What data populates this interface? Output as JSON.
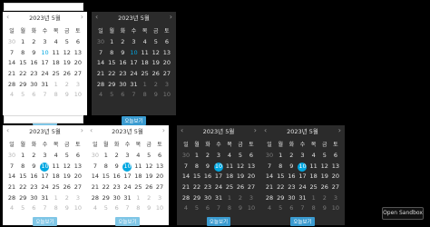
{
  "calendar": {
    "title": "2023년 5월",
    "weekdays": [
      "일",
      "월",
      "화",
      "수",
      "목",
      "금",
      "토"
    ],
    "today_label": "오늘보기",
    "weeks": [
      [
        "30",
        "1",
        "2",
        "3",
        "4",
        "5",
        "6"
      ],
      [
        "7",
        "8",
        "9",
        "10",
        "11",
        "12",
        "13"
      ],
      [
        "14",
        "15",
        "16",
        "17",
        "18",
        "19",
        "20"
      ],
      [
        "21",
        "22",
        "23",
        "24",
        "25",
        "26",
        "27"
      ],
      [
        "28",
        "29",
        "30",
        "31",
        "1",
        "2",
        "3"
      ],
      [
        "4",
        "5",
        "6",
        "7",
        "8",
        "9",
        "10"
      ]
    ]
  },
  "sandbox": {
    "label": "Open Sandbox"
  }
}
